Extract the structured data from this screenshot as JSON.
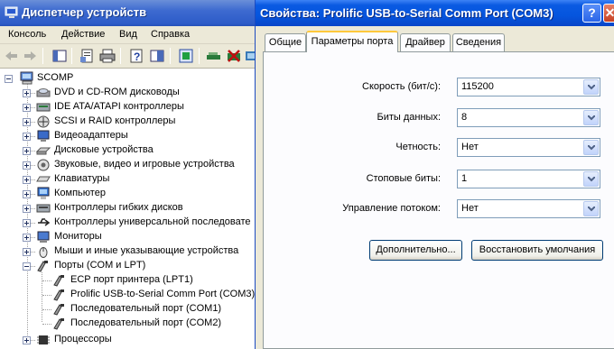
{
  "device_manager": {
    "title": "Диспетчер устройств",
    "menu": [
      "Консоль",
      "Действие",
      "Вид",
      "Справка"
    ],
    "toolbar_icons": [
      "back-arrow-icon",
      "forward-arrow-icon",
      "tree-view-icon",
      "properties-icon",
      "print-icon",
      "help-icon",
      "console-tree-icon",
      "update-driver-icon",
      "scan-hardware-icon",
      "disable-device-icon",
      "uninstall-device-icon"
    ],
    "tree": {
      "root": "SCOMP",
      "categories": [
        {
          "label": "DVD и CD-ROM дисководы",
          "icon": "cdrom-icon"
        },
        {
          "label": "IDE ATA/ATAPI контроллеры",
          "icon": "ide-controller-icon"
        },
        {
          "label": "SCSI и RAID контроллеры",
          "icon": "scsi-controller-icon"
        },
        {
          "label": "Видеоадаптеры",
          "icon": "display-adapter-icon"
        },
        {
          "label": "Дисковые устройства",
          "icon": "disk-drive-icon"
        },
        {
          "label": "Звуковые, видео и игровые устройства",
          "icon": "sound-icon"
        },
        {
          "label": "Клавиатуры",
          "icon": "keyboard-icon"
        },
        {
          "label": "Компьютер",
          "icon": "computer-icon"
        },
        {
          "label": "Контроллеры гибких дисков",
          "icon": "floppy-controller-icon"
        },
        {
          "label": "Контроллеры универсальной последовате",
          "icon": "usb-controller-icon"
        },
        {
          "label": "Мониторы",
          "icon": "monitor-icon"
        },
        {
          "label": "Мыши и иные указывающие устройства",
          "icon": "mouse-icon"
        }
      ],
      "ports": {
        "label": "Порты (COM и LPT)",
        "children": [
          "ECP порт принтера (LPT1)",
          "Prolific USB-to-Serial Comm Port (COM3)",
          "Последовательный порт (COM1)",
          "Последовательный порт (COM2)"
        ]
      },
      "after": {
        "label": "Процессоры",
        "icon": "processor-icon"
      }
    }
  },
  "dialog": {
    "title": "Свойства: Prolific USB-to-Serial Comm Port (COM3)",
    "help_label": "?",
    "close_label": "✕",
    "tabs": [
      "Общие",
      "Параметры порта",
      "Драйвер",
      "Сведения"
    ],
    "active_tab": 1,
    "fields": [
      {
        "label": "Скорость (бит/с):",
        "value": "115200"
      },
      {
        "label": "Биты данных:",
        "value": "8"
      },
      {
        "label": "Четность:",
        "value": "Нет"
      },
      {
        "label": "Стоповые биты:",
        "value": "1"
      },
      {
        "label": "Управление потоком:",
        "value": "Нет"
      }
    ],
    "buttons": {
      "advanced": "Дополнительно...",
      "restore_defaults": "Восстановить умолчания"
    }
  }
}
